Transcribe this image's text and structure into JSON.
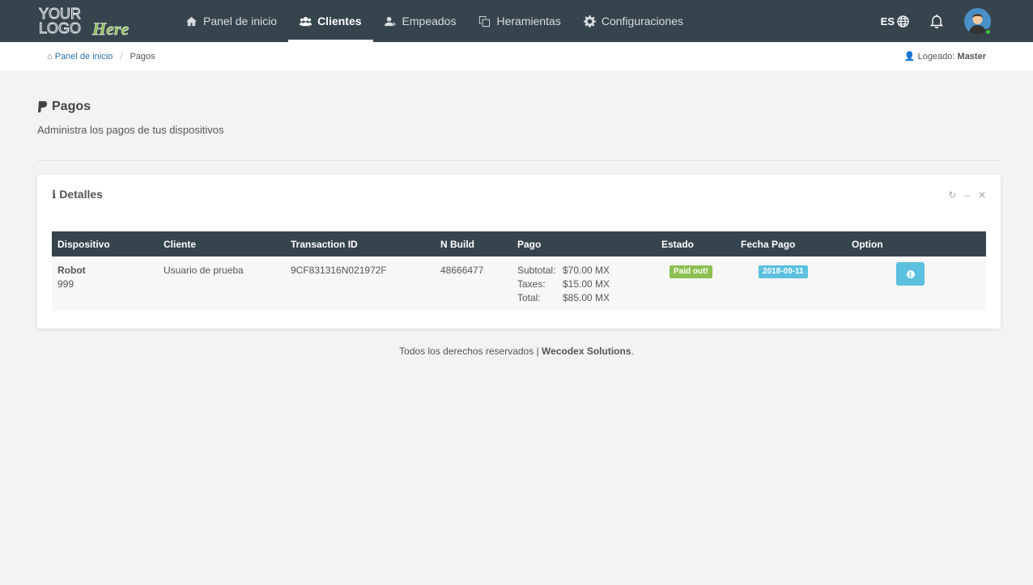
{
  "logo": {
    "text_line1": "YOUR",
    "text_line2": "LOGO",
    "text_script": "Here"
  },
  "nav": {
    "items": [
      {
        "label": "Panel de inicio",
        "icon": "home-icon"
      },
      {
        "label": "Clientes",
        "icon": "users-icon",
        "active": true
      },
      {
        "label": "Empeados",
        "icon": "user-plus-icon"
      },
      {
        "label": "Heramientas",
        "icon": "copy-icon"
      },
      {
        "label": "Configuraciones",
        "icon": "gear-icon"
      }
    ]
  },
  "topright": {
    "language": "ES"
  },
  "breadcrumb": {
    "home": "Panel de inicio",
    "separator": "/",
    "current": "Pagos"
  },
  "session": {
    "label": "Logeado:",
    "user": "Master"
  },
  "page": {
    "title": "Pagos",
    "subtitle": "Administra los pagos de tus dispositivos"
  },
  "card": {
    "title": "Detalles"
  },
  "table": {
    "headers": [
      "Dispositivo",
      "Cliente",
      "Transaction ID",
      "N Build",
      "Pago",
      "Estado",
      "Fecha Pago",
      "Option"
    ],
    "rows": [
      {
        "device_name": "Robot",
        "device_id": "999",
        "client": "Usuario de prueba",
        "transaction_id": "9CF831316N021972F",
        "build": "48666477",
        "subtotal_label": "Subtotal:",
        "subtotal": "$70.00 MX",
        "taxes_label": "Taxes:",
        "taxes": "$15.00 MX",
        "total_label": "Total:",
        "total": "$85.00 MX",
        "status": "Paid out!",
        "date": "2018-09-11"
      }
    ]
  },
  "footer": {
    "text": "Todos los derechos reservados |",
    "company": "Wecodex Solutions",
    "end": "."
  },
  "colors": {
    "nav": "#36444e",
    "success": "#8cc152",
    "info": "#5bc0de"
  }
}
